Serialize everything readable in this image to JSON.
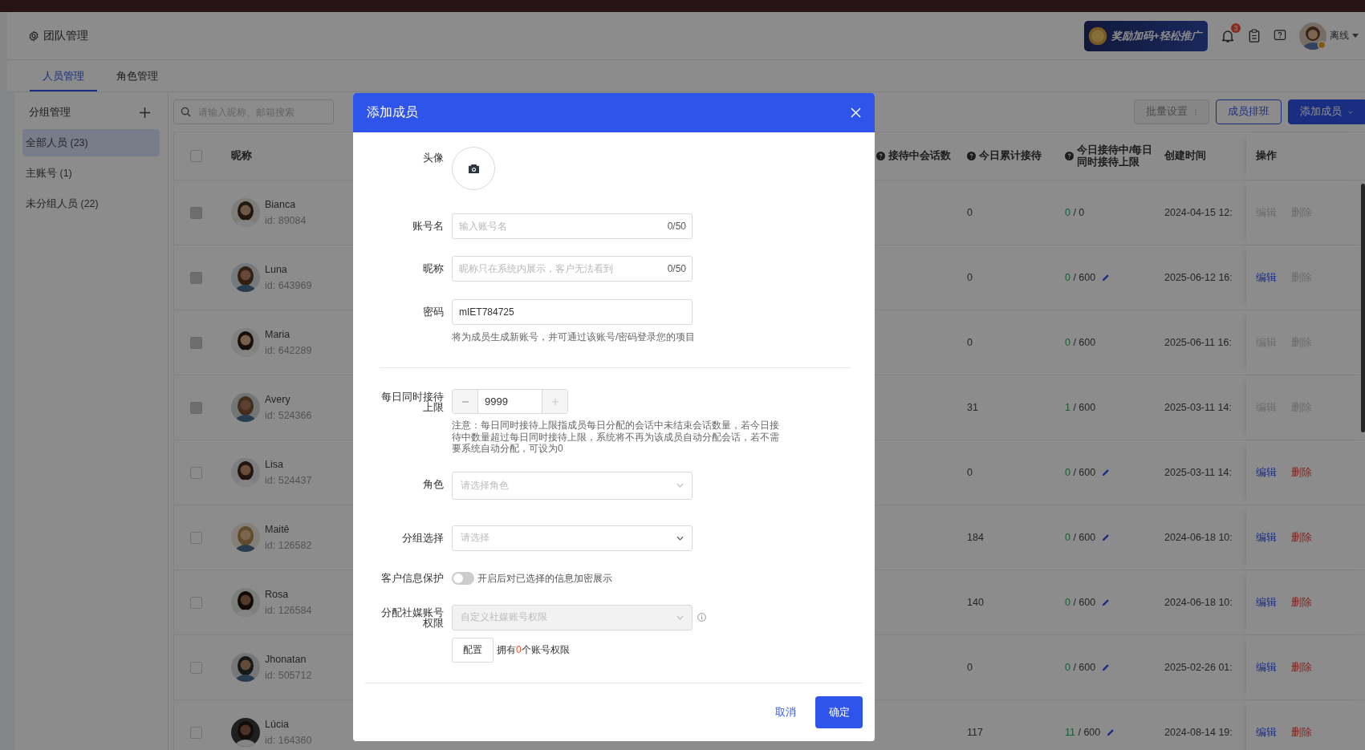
{
  "header": {
    "title": "团队管理",
    "promo": "奖励加码+轻松推广",
    "notification_count": "3",
    "status": "离线"
  },
  "tabs": [
    {
      "label": "人员管理",
      "selected": true
    },
    {
      "label": "角色管理",
      "selected": false
    }
  ],
  "sidebar": {
    "title": "分组管理",
    "items": [
      {
        "label": "全部人员 (23)",
        "selected": true
      },
      {
        "label": "主账号 (1)",
        "selected": false
      },
      {
        "label": "未分组人员 (22)",
        "selected": false
      }
    ]
  },
  "toolbar": {
    "search": {
      "placeholder": "请输入昵称、邮箱搜索"
    },
    "buttons": [
      {
        "label": "批量设置",
        "kind": "more",
        "disabled": true
      },
      {
        "label": "成员排班",
        "kind": "outline",
        "disabled": false
      },
      {
        "label": "添加成员",
        "kind": "dropdown",
        "disabled": false
      }
    ]
  },
  "table": {
    "select_all_checked": false,
    "columns": [
      {
        "label": "昵称",
        "help": false
      },
      {
        "label": "接待中会话数",
        "help": true
      },
      {
        "label": "今日累计接待",
        "help": true
      },
      {
        "label": "今日接待中/每日同时接待上限",
        "help": true
      },
      {
        "label": "创建时间",
        "help": false
      },
      {
        "label": "操作",
        "help": false
      }
    ],
    "rows": [
      {
        "name": "Bianca",
        "id": "id: 89084",
        "disabled": true,
        "today_total": "0",
        "active": "0",
        "limit": "/ 0",
        "limit_editable": false,
        "created": "2024-04-15 12:",
        "edit": "编辑",
        "edit_enabled": false,
        "delete": "删除",
        "delete_enabled": false
      },
      {
        "name": "Luna",
        "id": "id: 643969",
        "disabled": true,
        "today_total": "0",
        "active": "0",
        "limit": "/ 600",
        "limit_editable": true,
        "created": "2025-06-12 16:",
        "edit": "编辑",
        "edit_enabled": true,
        "delete": "删除",
        "delete_enabled": false
      },
      {
        "name": "Maria",
        "id": "id: 642289",
        "disabled": true,
        "today_total": "0",
        "active": "0",
        "limit": "/ 600",
        "limit_editable": false,
        "created": "2025-06-11 16:",
        "edit": "编辑",
        "edit_enabled": false,
        "delete": "删除",
        "delete_enabled": false
      },
      {
        "name": "Avery",
        "id": "id: 524366",
        "disabled": true,
        "today_total": "31",
        "active": "1",
        "limit": "/ 600",
        "limit_editable": false,
        "created": "2025-03-11 14:",
        "edit": "编辑",
        "edit_enabled": false,
        "delete": "删除",
        "delete_enabled": false
      },
      {
        "name": "Lisa",
        "id": "id: 524437",
        "disabled": false,
        "today_total": "0",
        "active": "0",
        "limit": "/ 600",
        "limit_editable": true,
        "created": "2025-03-11 14:",
        "edit": "编辑",
        "edit_enabled": true,
        "delete": "删除",
        "delete_enabled": true
      },
      {
        "name": "Maitê",
        "id": "id: 126582",
        "disabled": false,
        "today_total": "184",
        "active": "0",
        "limit": "/ 600",
        "limit_editable": true,
        "created": "2024-06-18 10:",
        "edit": "编辑",
        "edit_enabled": true,
        "delete": "删除",
        "delete_enabled": true
      },
      {
        "name": "Rosa",
        "id": "id: 126584",
        "disabled": false,
        "today_total": "140",
        "active": "0",
        "limit": "/ 600",
        "limit_editable": true,
        "created": "2024-06-18 10:",
        "edit": "编辑",
        "edit_enabled": true,
        "delete": "删除",
        "delete_enabled": true
      },
      {
        "name": "Jhonatan",
        "id": "id: 505712",
        "disabled": false,
        "today_total": "0",
        "active": "0",
        "limit": "/ 600",
        "limit_editable": true,
        "created": "2025-02-26 01:",
        "edit": "编辑",
        "edit_enabled": true,
        "delete": "删除",
        "delete_enabled": true
      },
      {
        "name": "Lúcia",
        "id": "id: 164360",
        "disabled": false,
        "today_total": "117",
        "active": "11",
        "limit": "/ 600",
        "limit_editable": true,
        "created": "2024-08-14 19:",
        "edit": "编辑",
        "edit_enabled": true,
        "delete": "删除",
        "delete_enabled": true
      }
    ]
  },
  "dialog": {
    "title": "添加成员",
    "avatar_label": "头像",
    "fields": [
      {
        "kind": "text",
        "label": "账号名",
        "placeholder": "输入账号名",
        "counter": "0/50"
      },
      {
        "kind": "text",
        "label": "昵称",
        "placeholder": "昵称只在系统内展示，客户无法看到",
        "counter": "0/50"
      },
      {
        "kind": "password",
        "label": "密码",
        "value": "mIET784725",
        "hint": "将为成员生成新账号，并可通过该账号/密码登录您的项目"
      }
    ],
    "limit": {
      "label": "每日同时接待上限",
      "value": "9999",
      "note": "注意：每日同时接待上限指成员每日分配的会话中未结束会话数量，若今日接待中数量超过每日同时接待上限，系统将不再为该成员自动分配会话，若不需要系统自动分配，可设为0"
    },
    "selects": [
      {
        "label": "角色",
        "placeholder": "请选择角色"
      },
      {
        "label": "分组选择",
        "placeholder": "请选择"
      }
    ],
    "protection": {
      "label": "客户信息保护",
      "on": false,
      "description": "开启后对已选择的信息加密展示"
    },
    "social": {
      "label": "分配社媒账号权限",
      "placeholder": "自定义社媒账号权限",
      "disabled": true,
      "config_button": "配置",
      "count_prefix": "拥有",
      "count": "0",
      "count_suffix": "个账号权限"
    },
    "cancel": "取消",
    "confirm": "确定"
  }
}
